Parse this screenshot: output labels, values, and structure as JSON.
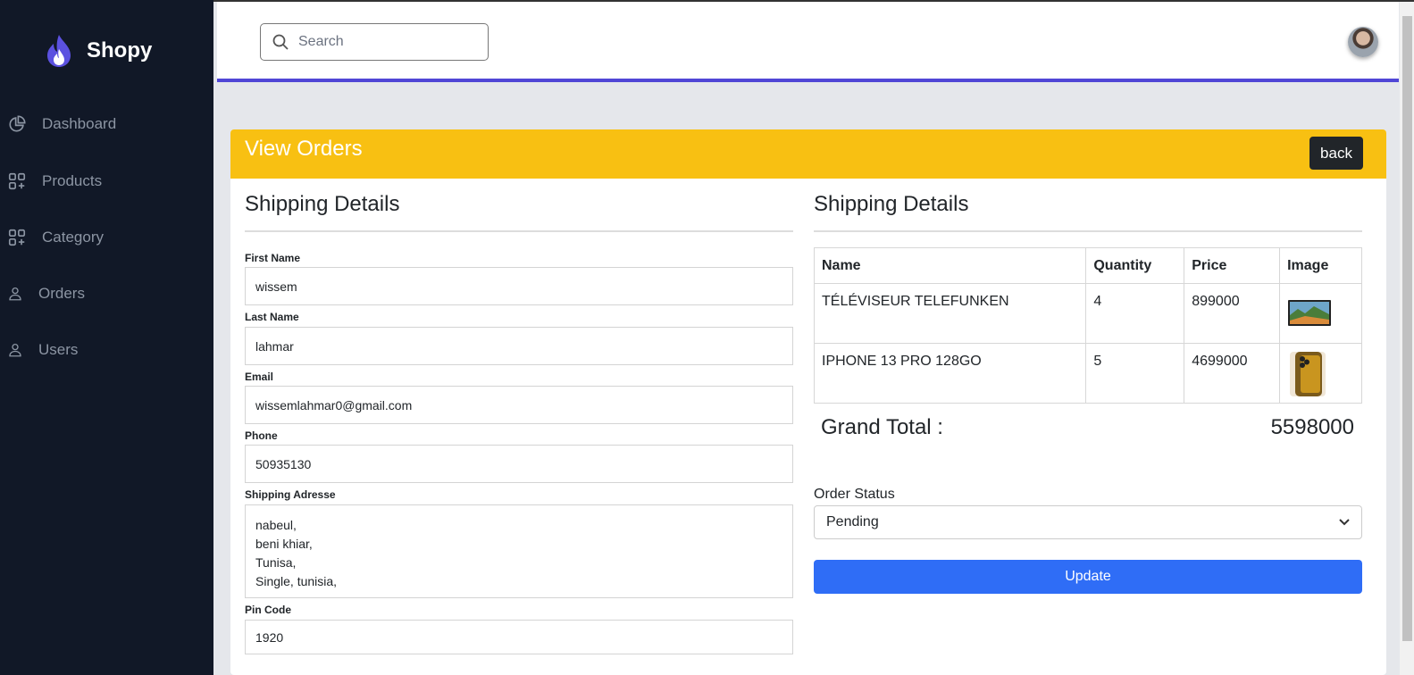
{
  "brand": {
    "name": "Shopy"
  },
  "sidebar": {
    "items": [
      {
        "label": "Dashboard",
        "icon": "chart-pie-icon"
      },
      {
        "label": "Products",
        "icon": "squares-plus-icon"
      },
      {
        "label": "Category",
        "icon": "squares-plus-icon"
      },
      {
        "label": "Orders",
        "icon": "user-icon"
      },
      {
        "label": "Users",
        "icon": "user-icon"
      }
    ]
  },
  "search": {
    "placeholder": "Search"
  },
  "card": {
    "title": "View Orders",
    "back_label": "back"
  },
  "shipping": {
    "title": "Shipping Details",
    "fields": [
      {
        "label": "First Name",
        "value": "wissem"
      },
      {
        "label": "Last Name",
        "value": "lahmar"
      },
      {
        "label": "Email",
        "value": "wissemlahmar0@gmail.com"
      },
      {
        "label": "Phone",
        "value": "50935130"
      },
      {
        "label": "Shipping Adresse",
        "lines": [
          "nabeul,",
          "beni khiar,",
          "Tunisa,",
          "Single, tunisia,"
        ]
      },
      {
        "label": "Pin Code",
        "value": "1920"
      }
    ]
  },
  "order": {
    "title": "Shipping Details",
    "columns": [
      "Name",
      "Quantity",
      "Price",
      "Image"
    ],
    "rows": [
      {
        "name": "TÉLÉVISEUR TELEFUNKEN",
        "quantity": "4",
        "price": "899000",
        "image": "tv-thumbnail"
      },
      {
        "name": "IPHONE 13 PRO 128GO",
        "quantity": "5",
        "price": "4699000",
        "image": "iphone-thumbnail"
      }
    ],
    "grand_total_label": "Grand Total :",
    "grand_total_value": "5598000",
    "status_label": "Order Status",
    "status_value": "Pending",
    "update_label": "Update"
  },
  "colors": {
    "sidebar": "#111827",
    "accent": "#5046d6",
    "header_bar": "#f8c012",
    "primary_button": "#2f6df6"
  }
}
